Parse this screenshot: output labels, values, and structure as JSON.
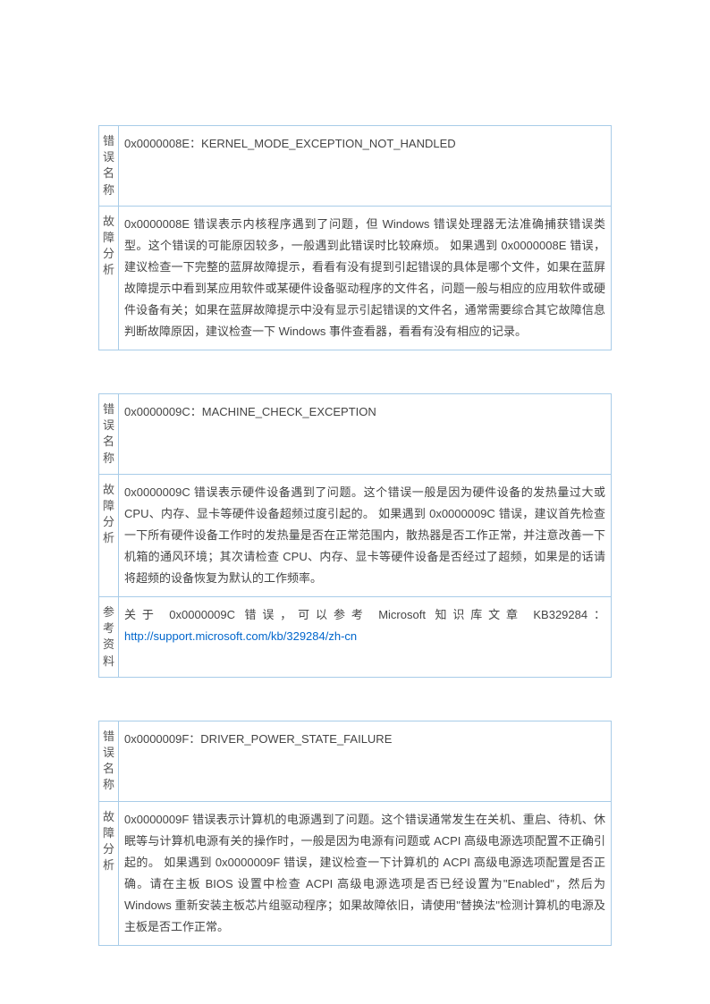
{
  "labels": {
    "name": "错误名称",
    "analysis": "故障分析",
    "ref": "参考资料"
  },
  "errors": [
    {
      "name": "0x0000008E：KERNEL_MODE_EXCEPTION_NOT_HANDLED",
      "analysis": "0x0000008E 错误表示内核程序遇到了问题，但 Windows 错误处理器无法准确捕获错误类型。这个错误的可能原因较多，一般遇到此错误时比较麻烦。 如果遇到 0x0000008E 错误，建议检查一下完整的蓝屏故障提示，看看有没有提到引起错误的具体是哪个文件，如果在蓝屏故障提示中看到某应用软件或某硬件设备驱动程序的文件名，问题一般与相应的应用软件或硬件设备有关；如果在蓝屏故障提示中没有显示引起错误的文件名，通常需要综合其它故障信息判断故障原因，建议检查一下 Windows 事件查看器，看看有没有相应的记录。"
    },
    {
      "name": "0x0000009C：MACHINE_CHECK_EXCEPTION",
      "analysis": "0x0000009C 错误表示硬件设备遇到了问题。这个错误一般是因为硬件设备的发热量过大或 CPU、内存、显卡等硬件设备超频过度引起的。 如果遇到 0x0000009C 错误，建议首先检查一下所有硬件设备工作时的发热量是否在正常范围内，散热器是否工作正常，并注意改善一下机箱的通风环境；其次请检查 CPU、内存、显卡等硬件设备是否经过了超频，如果是的话请将超频的设备恢复为默认的工作频率。",
      "ref_text": "关于 0x0000009C 错误，可以参考 Microsoft 知识库文章 KB329284：",
      "ref_link": "http://support.microsoft.com/kb/329284/zh-cn"
    },
    {
      "name": "0x0000009F：DRIVER_POWER_STATE_FAILURE",
      "analysis": "0x0000009F 错误表示计算机的电源遇到了问题。这个错误通常发生在关机、重启、待机、休眠等与计算机电源有关的操作时，一般是因为电源有问题或 ACPI 高级电源选项配置不正确引起的。 如果遇到 0x0000009F 错误，建议检查一下计算机的 ACPI 高级电源选项配置是否正确。请在主板 BIOS 设置中检查 ACPI 高级电源选项是否已经设置为\"Enabled\"，然后为 Windows 重新安装主板芯片组驱动程序；如果故障依旧，请使用\"替换法\"检测计算机的电源及主板是否工作正常。"
    }
  ]
}
